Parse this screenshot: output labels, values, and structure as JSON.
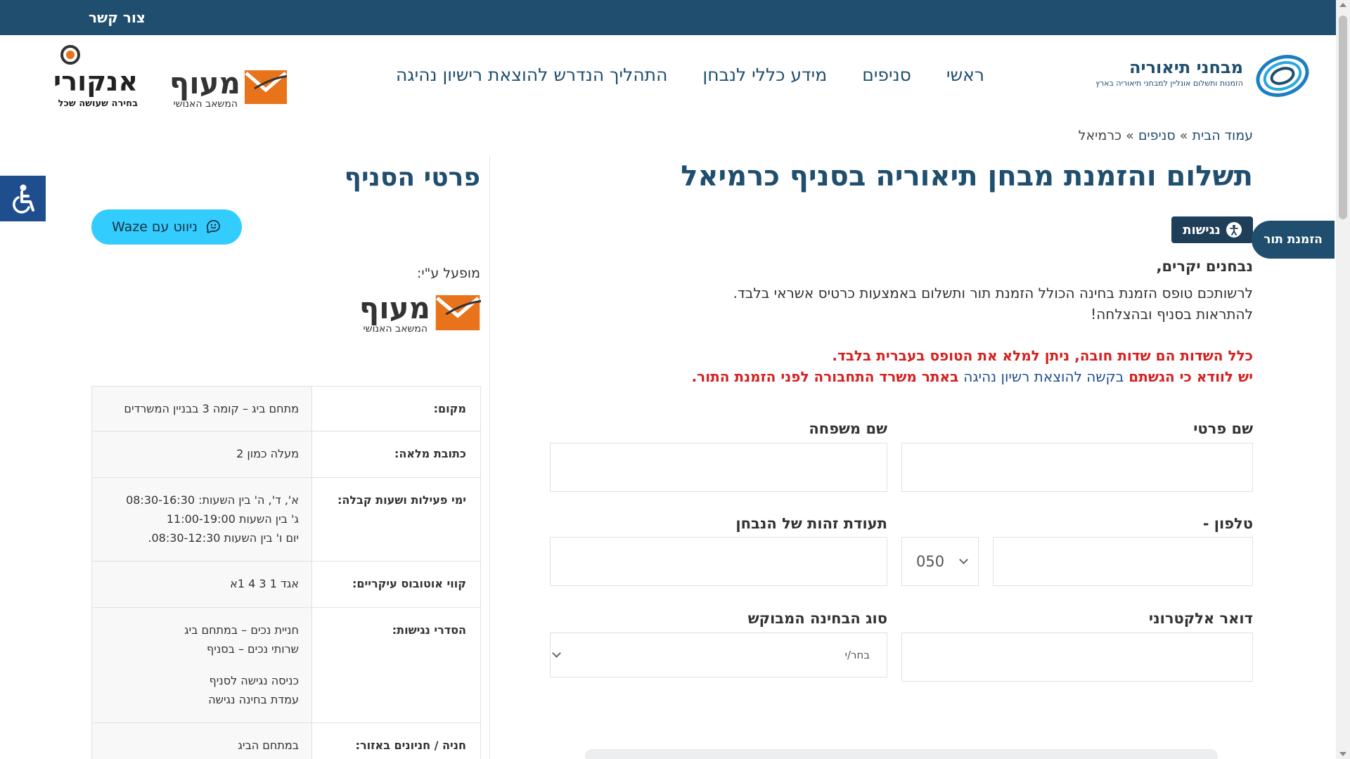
{
  "topbar": {
    "contact": "צור קשר"
  },
  "site": {
    "name": "מבחני תיאוריה",
    "tagline": "הזמנות ותשלום אונליין למבחני תיאוריה בארץ"
  },
  "nav": [
    "ראשי",
    "סניפים",
    "מידע כללי לנבחן",
    "התהליך הנדרש להוצאת רישיון נהיגה"
  ],
  "partners": {
    "maof": {
      "word": "מעוף",
      "sub": "המשאב האנושי"
    },
    "ankori": {
      "word": "אנקורי",
      "sub": "בחירה שעושה שכל"
    }
  },
  "breadcrumb": {
    "home": "עמוד הבית",
    "sep": "»",
    "branches": "סניפים",
    "current": "כרמיאל"
  },
  "page_title": "תשלום והזמנת מבחן תיאוריה בסניף כרמיאל",
  "accessibility_label": "נגישות",
  "book_tab": "הזמנת תור",
  "intro": {
    "greeting": "נבחנים יקרים,",
    "line1": "לרשותכם טופס הזמנת בחינה הכולל הזמנת תור ותשלום באמצעות כרטיס אשראי בלבד.",
    "line2": "להתראות בסניף ובהצלחה!"
  },
  "warnings": {
    "line1": "כלל השדות הם שדות חובה, ניתן למלא את הטופס בעברית בלבד.",
    "line2_a": "יש לוודא כי הגשתם ",
    "line2_link": "בקשה להוצאת רשיון נהיגה",
    "line2_b": " באתר משרד התחבורה לפני הזמנת התור."
  },
  "form": {
    "first_name": "שם פרטי",
    "last_name": "שם משפחה",
    "phone": "טלפון -",
    "phone_prefix": "050",
    "id_number": "תעודת זהות של הנבחן",
    "email": "דואר אלקטרוני",
    "exam_type": "סוג הבחינה המבוקש",
    "exam_type_placeholder": "בחר/י"
  },
  "sidebar": {
    "title": "פרטי הסניף",
    "waze": "ניווט עם Waze",
    "operated_by": "מופעל ע\"י:",
    "rows": [
      {
        "key": "מקום:",
        "lines": [
          "מתחם ביג – קומה 3 בבניין המשרדים"
        ]
      },
      {
        "key": "כתובת מלאה:",
        "lines": [
          "מעלה כמון 2"
        ]
      },
      {
        "key": "ימי פעילות ושעות קבלה:",
        "lines": [
          "א', ד', ה' בין השעות: 08:30-16:30",
          "ג' בין השעות 11:00-19:00",
          "יום ו' בין השעות 08:30-12:30."
        ]
      },
      {
        "key": "קווי אוטובוס עיקריים:",
        "lines": [
          "אגד 1 3 4 1א"
        ]
      },
      {
        "key": "הסדרי נגישות:",
        "lines": [
          "חניית נכים – במתחם ביג",
          "שרותי נכים – בסניף",
          "",
          "כניסה נגישה לסניף",
          "עמדת בחינה נגישה"
        ]
      },
      {
        "key": "חניה / חניונים באזור:",
        "lines": [
          "במתחם הביג"
        ]
      }
    ]
  }
}
